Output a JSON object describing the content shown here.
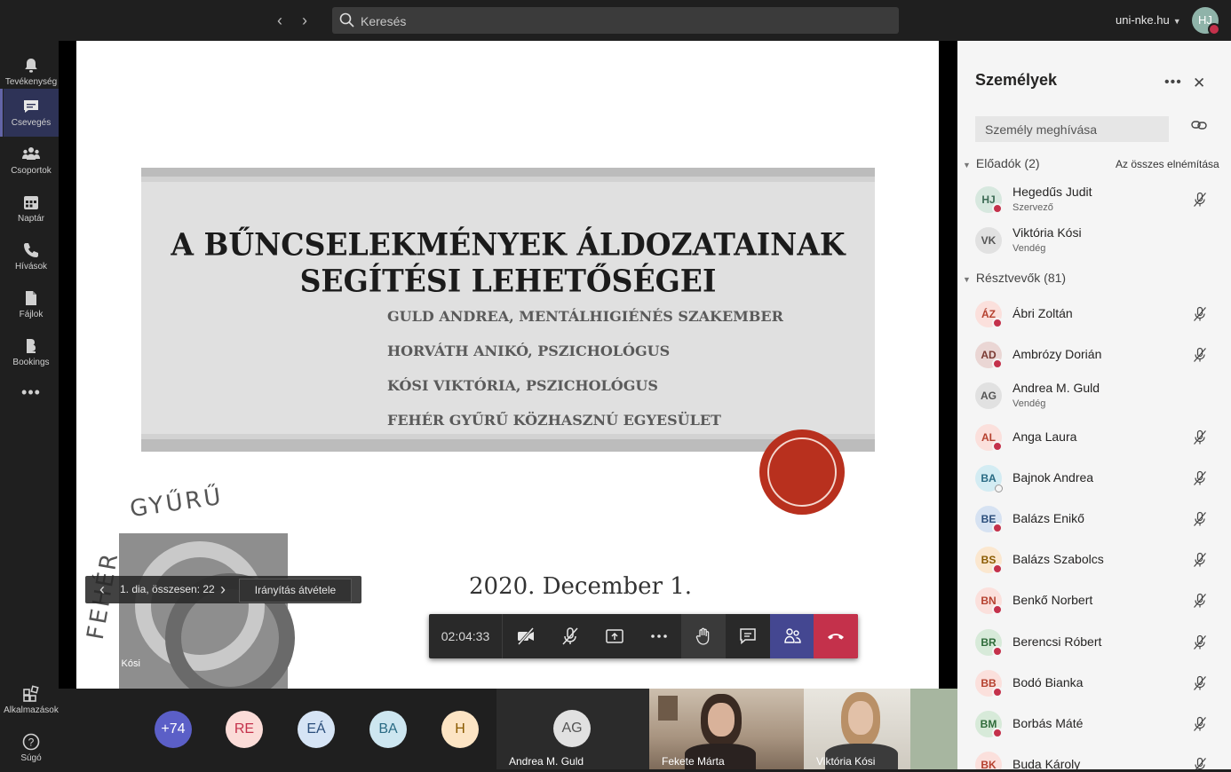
{
  "topbar": {
    "search_placeholder": "Keresés",
    "tenant": "uni-nke.hu",
    "user_initials": "HJ"
  },
  "rail": [
    {
      "label": "Tevékenység",
      "icon": "bell-icon"
    },
    {
      "label": "Csevegés",
      "icon": "chat-icon",
      "active": true
    },
    {
      "label": "Csoportok",
      "icon": "teams-icon"
    },
    {
      "label": "Naptár",
      "icon": "calendar-icon"
    },
    {
      "label": "Hívások",
      "icon": "phone-icon"
    },
    {
      "label": "Fájlok",
      "icon": "file-icon"
    },
    {
      "label": "Bookings",
      "icon": "bookings-icon"
    },
    {
      "label": "Alkalmazások",
      "icon": "apps-icon"
    },
    {
      "label": "Súgó",
      "icon": "help-icon"
    }
  ],
  "slide": {
    "title": "A BŰNCSELEKMÉNYEK ÁLDOZATAINAK SEGÍTÉSI LEHETŐSÉGEI",
    "lines": [
      "GULD ANDREA, MENTÁLHIGIÉNÉS SZAKEMBER",
      "HORVÁTH ANIKÓ, PSZICHOLÓGUS",
      "KÓSI VIKTÓRIA, PSZICHOLÓGUS",
      "FEHÉR GYŰRŰ KÖZHASZNÚ EGYESÜLET"
    ],
    "date": "2020. December 1.",
    "logo_text_top": "GYŰRŰ",
    "logo_text_left": "FEHÉR"
  },
  "slide_nav": {
    "counter": "1. dia, összesen: 22",
    "take_control": "Irányítás átvétele",
    "presenter": "Viktória Kósi"
  },
  "call": {
    "timer": "02:04:33"
  },
  "strip": {
    "avatars": [
      {
        "text": "+74",
        "bg": "#5b5fc7",
        "fg": "#ffffff"
      },
      {
        "text": "RE",
        "bg": "#fbdcd8",
        "fg": "#c4314b"
      },
      {
        "text": "EÁ",
        "bg": "#d6e4f5",
        "fg": "#2a4d7a"
      },
      {
        "text": "BA",
        "bg": "#cde6f0",
        "fg": "#2a6b84"
      },
      {
        "text": "H",
        "bg": "#fce4c4",
        "fg": "#8a5a00"
      }
    ],
    "tiles": [
      {
        "name": "Andrea M. Guld",
        "initials": "AG"
      },
      {
        "name": "Fekete Márta"
      },
      {
        "name": "Viktória Kósi"
      }
    ]
  },
  "panel": {
    "title": "Személyek",
    "invite_placeholder": "Személy meghívása",
    "presenters_label": "Előadók",
    "presenters_count": "(2)",
    "mute_all": "Az összes elnémítása",
    "attendees_label": "Résztvevők",
    "attendees_count": "(81)",
    "presenters": [
      {
        "initials": "HJ",
        "name": "Hegedűs Judit",
        "role": "Szervező",
        "bg": "#d7e8df",
        "fg": "#3d6b55",
        "status": "busy",
        "mic": true
      },
      {
        "initials": "VK",
        "name": "Viktória Kósi",
        "role": "Vendég",
        "bg": "#e1e1e1",
        "fg": "#555555",
        "status": "",
        "mic": false
      }
    ],
    "attendees": [
      {
        "initials": "ÁZ",
        "name": "Ábri Zoltán",
        "role": "",
        "bg": "#fbe0dc",
        "fg": "#b5412f",
        "status": "busy",
        "mic": true
      },
      {
        "initials": "AD",
        "name": "Ambrózy Dorián",
        "role": "",
        "bg": "#ead6d4",
        "fg": "#7a3a33",
        "status": "busy",
        "mic": true
      },
      {
        "initials": "AG",
        "name": "Andrea M. Guld",
        "role": "Vendég",
        "bg": "#e1e1e1",
        "fg": "#555555",
        "status": "",
        "mic": false
      },
      {
        "initials": "AL",
        "name": "Anga Laura",
        "role": "",
        "bg": "#fbe0dc",
        "fg": "#b5412f",
        "status": "busy",
        "mic": true
      },
      {
        "initials": "BA",
        "name": "Bajnok Andrea",
        "role": "",
        "bg": "#d3ecf3",
        "fg": "#2a6b84",
        "status": "away",
        "mic": true
      },
      {
        "initials": "BE",
        "name": "Balázs Enikő",
        "role": "",
        "bg": "#d6e2f2",
        "fg": "#2a4d7a",
        "status": "busy",
        "mic": true
      },
      {
        "initials": "BS",
        "name": "Balázs Szabolcs",
        "role": "",
        "bg": "#fbe7cf",
        "fg": "#8a5a00",
        "status": "busy",
        "mic": true
      },
      {
        "initials": "BN",
        "name": "Benkő Norbert",
        "role": "",
        "bg": "#fbe0dc",
        "fg": "#b5412f",
        "status": "busy",
        "mic": true
      },
      {
        "initials": "BR",
        "name": "Berencsi Róbert",
        "role": "",
        "bg": "#d7ead9",
        "fg": "#2f6b3a",
        "status": "busy",
        "mic": true
      },
      {
        "initials": "BB",
        "name": "Bodó Bianka",
        "role": "",
        "bg": "#fbe0dc",
        "fg": "#b5412f",
        "status": "busy",
        "mic": true
      },
      {
        "initials": "BM",
        "name": "Borbás Máté",
        "role": "",
        "bg": "#d7ead9",
        "fg": "#2f6b3a",
        "status": "busy",
        "mic": true
      },
      {
        "initials": "BK",
        "name": "Buda Károly",
        "role": "",
        "bg": "#fbe0dc",
        "fg": "#b5412f",
        "status": "busy",
        "mic": true
      }
    ]
  }
}
